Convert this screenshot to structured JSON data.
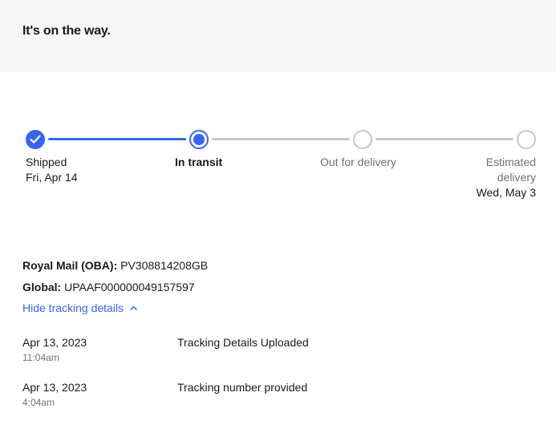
{
  "banner": {
    "title": "It's on the way."
  },
  "tracker": {
    "accent_color": "#3665f3",
    "inactive_color": "#c7c7c7",
    "steps": [
      {
        "status": "done",
        "label": "Shipped",
        "sub": "Fri, Apr 14"
      },
      {
        "status": "current",
        "label": "In transit",
        "sub": ""
      },
      {
        "status": "todo",
        "label": "Out for delivery",
        "sub": ""
      },
      {
        "status": "todo",
        "label_line1": "Estimated",
        "label_line2": "delivery",
        "sub": "Wed, May 3"
      }
    ]
  },
  "tracking": {
    "carrier_label": "Royal Mail (OBA):",
    "carrier_number": "PV308814208GB",
    "global_label": "Global:",
    "global_number": "UPAAF000000049157597",
    "toggle_label": "Hide tracking details",
    "toggle_icon": "chevron-up-icon"
  },
  "events": [
    {
      "date": "Apr 13, 2023",
      "time": "11:04am",
      "description": "Tracking Details Uploaded"
    },
    {
      "date": "Apr 13, 2023",
      "time": "4:04am",
      "description": "Tracking number provided"
    }
  ]
}
